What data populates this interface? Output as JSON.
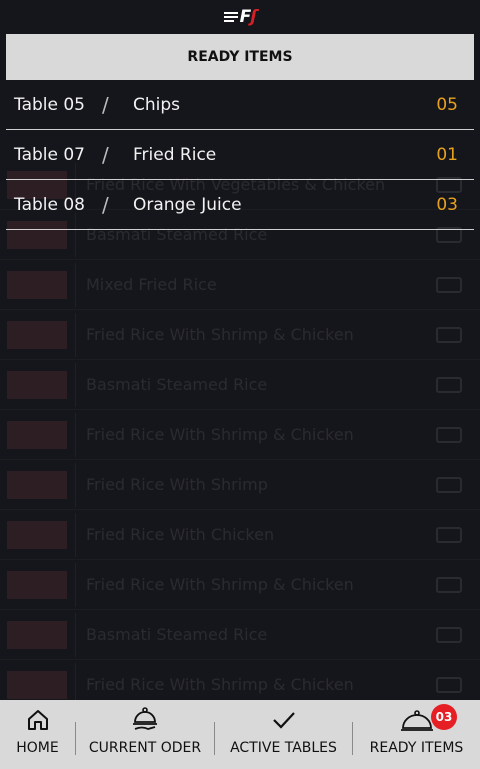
{
  "app": {
    "logo_text": "F"
  },
  "ready_panel": {
    "title": "READY ITEMS",
    "items": [
      {
        "table": "Table 05",
        "item": "Chips",
        "qty": "05"
      },
      {
        "table": "Table 07",
        "item": "Fried Rice",
        "qty": "01"
      },
      {
        "table": "Table 08",
        "item": "Orange Juice",
        "qty": "03"
      }
    ]
  },
  "background_list": [
    "Fried Rice With Vegetables & Chicken",
    "Basmati Steamed Rice",
    "Mixed Fried Rice",
    "Fried Rice With Shrimp & Chicken",
    "Basmati Steamed Rice",
    "Fried Rice With Shrimp & Chicken",
    "Fried Rice With Shrimp",
    "Fried Rice With Chicken",
    "Fried Rice With Shrimp & Chicken",
    "Basmati Steamed Rice",
    "Fried Rice With Shrimp & Chicken"
  ],
  "bottom_nav": {
    "home": "HOME",
    "current_order": "CURRENT ODER",
    "active_tables": "ACTIVE TABLES",
    "ready_items": "READY ITEMS",
    "ready_badge": "03"
  },
  "colors": {
    "accent": "#e8a11d",
    "brand": "#d81f26",
    "badge": "#e51f24"
  }
}
